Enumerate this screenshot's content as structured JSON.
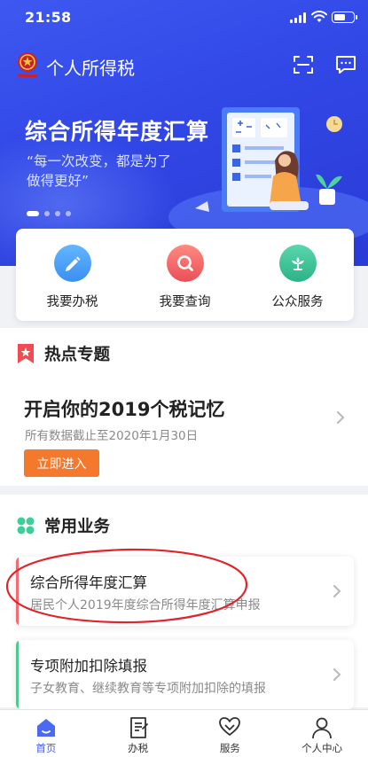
{
  "status_bar": {
    "time": "21:58"
  },
  "header": {
    "app_title": "个人所得税"
  },
  "banner": {
    "title": "综合所得年度汇算",
    "quote_line1": "“每一次改变，都是为了",
    "quote_line2": "做得更好”",
    "slides": 4,
    "active_slide": 1
  },
  "quick_actions": [
    {
      "label": "我要办税",
      "icon": "pencil-icon",
      "color": "#4ea3f6"
    },
    {
      "label": "我要查询",
      "icon": "magnifier-icon",
      "color": "#f2676b"
    },
    {
      "label": "公众服务",
      "icon": "flower-icon",
      "color": "#39c39a"
    }
  ],
  "hot_topics": {
    "section_title": "热点专题",
    "title": "开启你的2019个税记忆",
    "subtitle": "所有数据截止至2020年1月30日",
    "button_label": "立即进入"
  },
  "common_services": {
    "section_title": "常用业务",
    "items": [
      {
        "title": "综合所得年度汇算",
        "subtitle": "居民个人2019年度综合所得年度汇算申报",
        "accent": "#f26b73"
      },
      {
        "title": "专项附加扣除填报",
        "subtitle": "子女教育、继续教育等专项附加扣除的填报",
        "accent": "#4cc98d"
      }
    ]
  },
  "tabs": [
    {
      "label": "首页",
      "icon": "home-icon",
      "active": true
    },
    {
      "label": "办税",
      "icon": "document-icon",
      "active": false
    },
    {
      "label": "服务",
      "icon": "heart-hands-icon",
      "active": false
    },
    {
      "label": "个人中心",
      "icon": "person-icon",
      "active": false
    }
  ],
  "colors": {
    "brand_blue": "#3147e6",
    "orange_button": "#f5792c",
    "active_tab": "#3e5ff0",
    "annotation_red": "#e0242b"
  }
}
